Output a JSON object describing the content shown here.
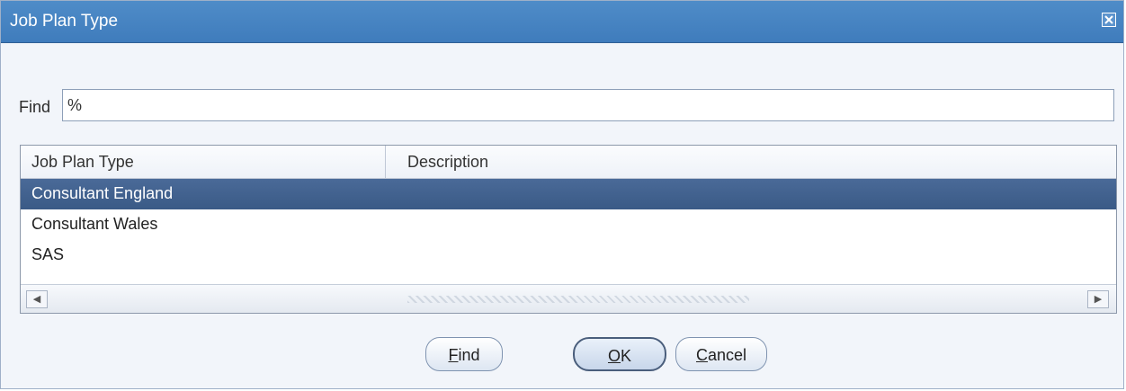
{
  "dialog": {
    "title": "Job Plan Type"
  },
  "find": {
    "label": "Find",
    "value": "%"
  },
  "table": {
    "columns": [
      "Job Plan Type",
      "Description"
    ],
    "rows": [
      {
        "type": "Consultant England",
        "description": "",
        "selected": true
      },
      {
        "type": "Consultant Wales",
        "description": "",
        "selected": false
      },
      {
        "type": "SAS",
        "description": "",
        "selected": false
      }
    ]
  },
  "buttons": {
    "find": {
      "mnemonic": "F",
      "rest": "ind"
    },
    "ok": {
      "mnemonic": "O",
      "rest": "K"
    },
    "cancel": {
      "mnemonic": "C",
      "rest": "ancel"
    }
  },
  "icons": {
    "close": "close-icon",
    "scroll_left": "left-arrow-icon",
    "scroll_right": "right-arrow-icon"
  },
  "colors": {
    "titlebar": "#4f8cc8",
    "selection": "#4a6a98"
  }
}
